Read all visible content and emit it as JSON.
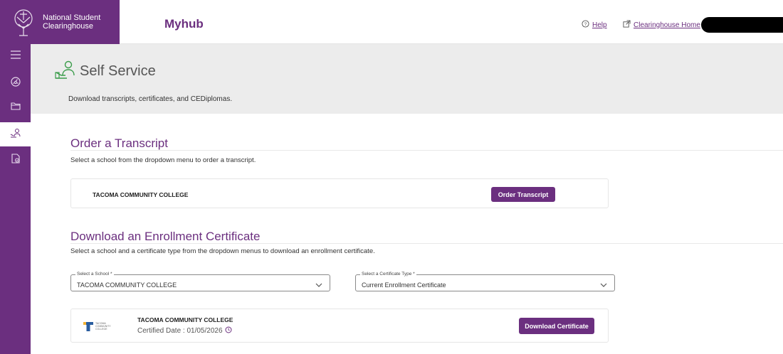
{
  "header": {
    "brand_line1": "National Student",
    "brand_line2": "Clearinghouse",
    "app_title": "Myhub",
    "help_label": "Help",
    "home_label": "Clearinghouse Home"
  },
  "sidebar": {
    "items": [
      {
        "icon": "menu-icon"
      },
      {
        "icon": "dashboard-icon"
      },
      {
        "icon": "folder-icon"
      },
      {
        "icon": "self-service-icon",
        "active": true
      },
      {
        "icon": "document-check-icon"
      }
    ]
  },
  "banner": {
    "title": "Self Service",
    "subtitle": "Download transcripts, certificates, and CEDiplomas."
  },
  "transcript": {
    "title": "Order a Transcript",
    "description": "Select a school from the dropdown menu to order a transcript.",
    "school": "TACOMA COMMUNITY COLLEGE",
    "button_label": "Order Transcript"
  },
  "enrollment": {
    "title": "Download an Enrollment Certificate",
    "description": "Select a school and a certificate type from the dropdown menus to download an enrollment certificate.",
    "school_select": {
      "label": "Select a School *",
      "value": "TACOMA COMMUNITY COLLEGE"
    },
    "type_select": {
      "label": "Select a Certificate Type *",
      "value": "Current Enrollment Certificate"
    },
    "card": {
      "school": "TACOMA COMMUNITY COLLEGE",
      "certified_date": "Certified Date : 01/05/2026",
      "button_label": "Download Certificate",
      "logo_text": "TACOMA COMMUNITY COLLEGE"
    }
  },
  "colors": {
    "brand_purple": "#6b2f7f",
    "banner_gray": "#ececec"
  }
}
